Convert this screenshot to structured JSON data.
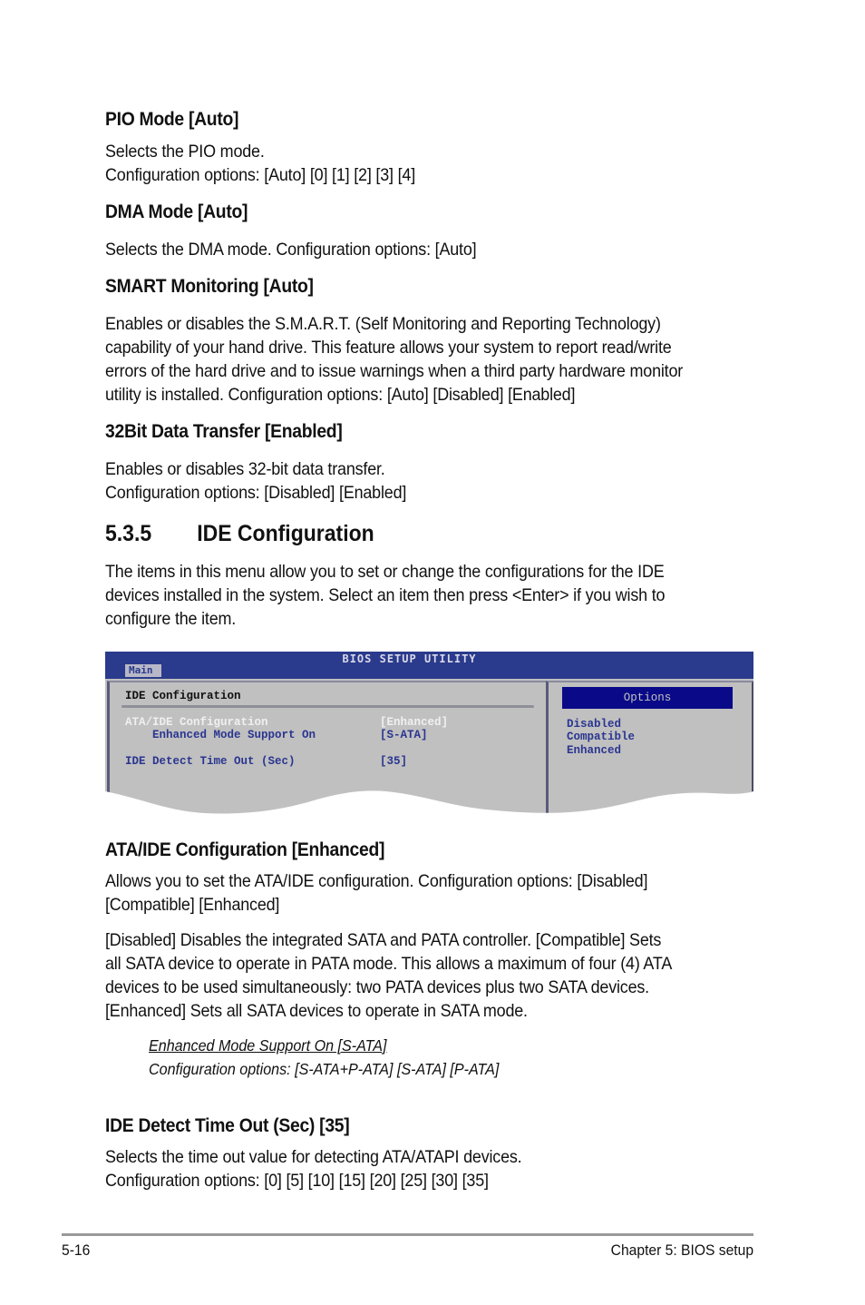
{
  "sections": {
    "pio": {
      "heading": "PIO Mode [Auto]",
      "lines": [
        "Selects the PIO mode.",
        "Configuration options: [Auto] [0] [1] [2] [3] [4]"
      ]
    },
    "dma": {
      "heading": "DMA Mode [Auto]",
      "lines": [
        "Selects the DMA mode. Configuration options: [Auto]"
      ]
    },
    "smart": {
      "heading": "SMART Monitoring [Auto]",
      "lines": [
        "Enables or disables the S.M.A.R.T. (Self Monitoring and Reporting Technology)",
        "capability of your hand drive. This feature allows your system to report read/write",
        "errors of the hard drive and to issue warnings when a third party hardware monitor",
        "utility is installed. Configuration options: [Auto] [Disabled] [Enabled]"
      ]
    },
    "bit32": {
      "heading": "32Bit Data Transfer [Enabled]",
      "lines": [
        "Enables or disables 32-bit data transfer.",
        "Configuration options: [Disabled] [Enabled]"
      ]
    },
    "ide_config": {
      "number": "5.3.5",
      "title": "IDE Configuration",
      "lines": [
        "The items in this menu allow you to set or change the configurations for the IDE",
        "devices installed in the system. Select an item then press <Enter> if you wish to",
        "configure the item."
      ]
    },
    "ata_ide": {
      "heading": "ATA/IDE Configuration [Enhanced]",
      "para1": [
        "Allows you to set the ATA/IDE configuration. Configuration options: [Disabled]",
        "[Compatible] [Enhanced]"
      ],
      "para2": [
        "[Disabled] Disables the integrated SATA and PATA controller. [Compatible] Sets",
        "all SATA device to operate in PATA mode. This allows a maximum of four (4) ATA",
        "devices to be used simultaneously: two PATA devices plus two SATA devices.",
        "[Enhanced] Sets all SATA devices to operate in SATA mode."
      ],
      "note_heading": "Enhanced Mode Support On [S-ATA]",
      "note_line": "Configuration options: [S-ATA+P-ATA] [S-ATA] [P-ATA]"
    },
    "ide_timeout": {
      "heading": "IDE Detect Time Out (Sec) [35]",
      "lines": [
        "Selects the time out value for detecting ATA/ATAPI devices.",
        "Configuration options: [0] [5] [10] [15] [20] [25] [30] [35]"
      ]
    }
  },
  "bios": {
    "title": "BIOS SETUP UTILITY",
    "tab": "Main",
    "panel_title": "IDE Configuration",
    "rows": [
      {
        "label": "ATA/IDE Configuration",
        "value": "[Enhanced]",
        "selected": true
      },
      {
        "label": "    Enhanced Mode Support On",
        "value": "[S-ATA]",
        "selected": false
      },
      {
        "label": "IDE Detect Time Out (Sec)",
        "value": "[35]",
        "selected": false
      }
    ],
    "options_header": "Options",
    "options": [
      "Disabled",
      "Compatible",
      "Enhanced"
    ],
    "colors": {
      "title_bar": "#2a3a8c",
      "panel_bg": "#c0c0c0",
      "item_text": "#2a3590",
      "options_header_bg": "#0a0a88"
    }
  },
  "footer": {
    "page_number": "5-16",
    "chapter": "Chapter 5: BIOS setup"
  }
}
